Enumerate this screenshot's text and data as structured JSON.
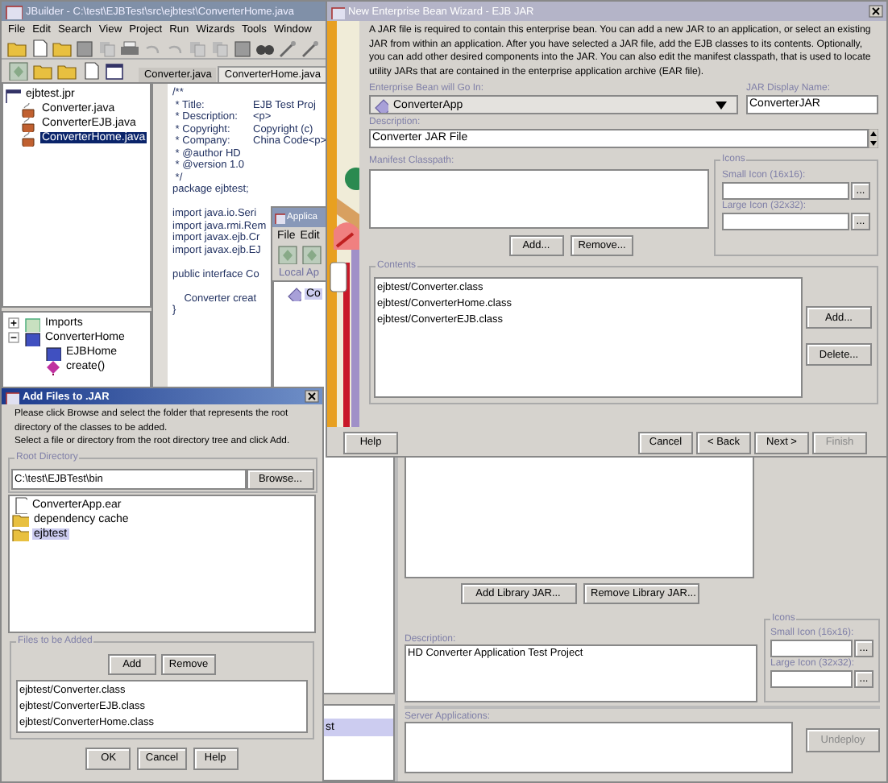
{
  "ide": {
    "title": "JBuilder - C:\\test\\EJBTest\\src\\ejbtest\\ConverterHome.java",
    "menu": [
      "File",
      "Edit",
      "Search",
      "View",
      "Project",
      "Run",
      "Wizards",
      "Tools",
      "Window"
    ],
    "editor_tabs": [
      {
        "label": "Converter.java",
        "selected": false
      },
      {
        "label": "ConverterHome.java",
        "selected": true
      }
    ],
    "project": {
      "label": "ejbtest.jpr",
      "children": [
        {
          "label": "Converter.java",
          "selected": false
        },
        {
          "label": "ConverterEJB.java",
          "selected": false
        },
        {
          "label": "ConverterHome.java",
          "selected": true
        }
      ]
    },
    "code": [
      {
        "text": "/**"
      },
      {
        "text": " * Title:",
        "value": "EJB Test Proj"
      },
      {
        "text": " * Description:",
        "value": "<p>"
      },
      {
        "text": " * Copyright:",
        "value": "Copyright (c)"
      },
      {
        "text": " * Company:",
        "value": "China Code<p>"
      },
      {
        "text": " * @author HD"
      },
      {
        "text": " * @version 1.0"
      },
      {
        "text": " */"
      },
      {
        "text": "package ejbtest;"
      },
      {
        "text": "import java.io.Seri",
        "gap_before": true
      },
      {
        "text": "import java.rmi.Rem"
      },
      {
        "text": "import javax.ejb.Cr"
      },
      {
        "text": "import javax.ejb.EJ"
      },
      {
        "text": "public interface Co",
        "gap_before": true
      },
      {
        "text": "    Converter creat",
        "gap_before": true
      },
      {
        "text": "}"
      }
    ],
    "structure": [
      {
        "label": "Imports",
        "expanded": false
      },
      {
        "label": "ConverterHome",
        "expanded": true,
        "children": [
          {
            "label": "EJBHome"
          },
          {
            "label": "create()"
          }
        ]
      }
    ]
  },
  "deploy_tool": {
    "title": "Applica",
    "menu": [
      "File",
      "Edit"
    ],
    "tree_label": "Local Ap",
    "tree_items": [
      {
        "label": "Co",
        "selected": true
      }
    ],
    "app_items": [
      {
        "label": "st",
        "selected": true
      }
    ],
    "library_buttons": [
      "Add Library JAR...",
      "Remove Library JAR..."
    ],
    "description": {
      "label": "Description:",
      "value": "HD Converter Application Test Project"
    },
    "icons": {
      "label": "Icons",
      "small": "Small Icon (16x16):",
      "small_button": "...",
      "large": "Large Icon (32x32):",
      "large_button": "..."
    },
    "server": {
      "label": "Server Applications:",
      "button": {
        "label": "Undeploy",
        "disabled": true
      }
    }
  },
  "wizard": {
    "title": "New Enterprise Bean Wizard - EJB JAR",
    "intro": "A JAR file is required to contain this enterprise bean. You can add a new JAR to an application, or select an existing JAR from within an application. After you have selected a JAR file, add the EJB classes to its contents. Optionally, you can add other desired components into the JAR. You can also edit the manifest classpath, that is used to locate utility JARs that are contained in the enterprise application archive (EAR file).",
    "bean_location": {
      "label": "Enterprise Bean will Go In:",
      "value": "ConverterApp"
    },
    "display_name": {
      "label": "JAR Display Name:",
      "value": "ConverterJAR"
    },
    "description": {
      "label": "Description:",
      "value": "Converter JAR File"
    },
    "manifest": {
      "label": "Manifest Classpath:",
      "buttons": [
        "Add...",
        "Remove..."
      ]
    },
    "icons": {
      "label": "Icons",
      "small": "Small Icon (16x16):",
      "small_button": "...",
      "large": "Large Icon (32x32):",
      "large_button": "..."
    },
    "contents": {
      "label": "Contents",
      "items": [
        "ejbtest/Converter.class",
        "ejbtest/ConverterHome.class",
        "ejbtest/ConverterEJB.class"
      ],
      "buttons": [
        "Add...",
        "Delete..."
      ]
    },
    "buttons": [
      {
        "label": "Help",
        "disabled": false
      },
      {
        "label": "Cancel",
        "disabled": false
      },
      {
        "label": "< Back",
        "disabled": false
      },
      {
        "label": "Next >",
        "disabled": false
      },
      {
        "label": "Finish",
        "disabled": true
      }
    ]
  },
  "add_files": {
    "title": "Add Files to .JAR",
    "instructions": [
      "Please click Browse and select the folder that represents the root directory of the classes to be added.",
      "Select a file or directory from the root directory tree and click Add."
    ],
    "root_directory": {
      "label": "Root Directory",
      "value": "C:\\test\\EJBTest\\bin",
      "button": "Browse..."
    },
    "files": [
      {
        "name": "ConverterApp.ear",
        "kind": "file",
        "selected": false
      },
      {
        "name": "dependency cache",
        "kind": "folder",
        "selected": false
      },
      {
        "name": "ejbtest",
        "kind": "folder",
        "selected": true
      }
    ],
    "to_add": {
      "label": "Files to be Added",
      "buttons": [
        "Add",
        "Remove"
      ],
      "items": [
        "ejbtest/Converter.class",
        "ejbtest/ConverterEJB.class",
        "ejbtest/ConverterHome.class"
      ]
    },
    "buttons": [
      "OK",
      "Cancel",
      "Help"
    ]
  }
}
